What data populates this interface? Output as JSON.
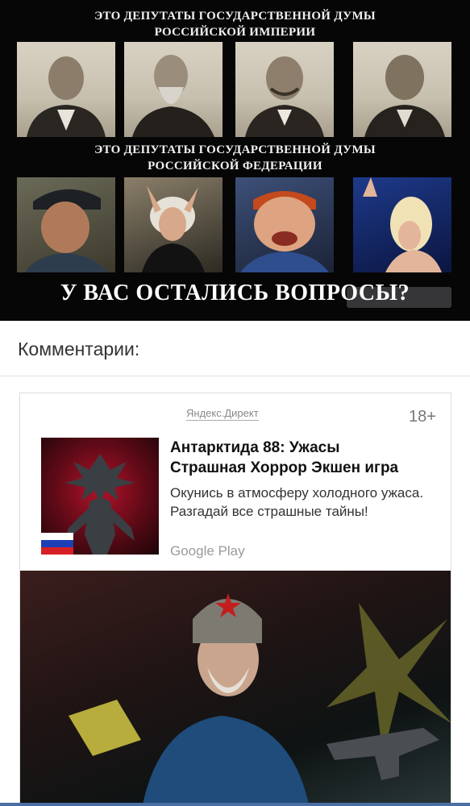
{
  "meme": {
    "heading_top_line1": "ЭТО ДЕПУТАТЫ ГОСУДАРСТВЕННОЙ ДУМЫ",
    "heading_top_line2": "РОССИЙСКОЙ ИМПЕРИИ",
    "heading_bottom_line1": "ЭТО ДЕПУТАТЫ ГОСУДАРСТВЕННОЙ ДУМЫ",
    "heading_bottom_line2": "РОССИЙСКОЙ ФЕДЕРАЦИИ",
    "question": "У ВАС ОСТАЛИСЬ ВОПРОСЫ?"
  },
  "comments": {
    "title": "Комментарии:"
  },
  "ad": {
    "source": "Яндекс.Директ",
    "age_rating": "18+",
    "title_line1": "Антарктида 88: Ужасы",
    "title_line2": "Страшная Хоррор Экшен игра",
    "description": "Окунись в атмосферу холодного ужаса. Разгадай все страшные тайны!",
    "store": "Google Play",
    "flag_colors": [
      "#ffffff",
      "#1c3fb5",
      "#d71f26"
    ]
  }
}
